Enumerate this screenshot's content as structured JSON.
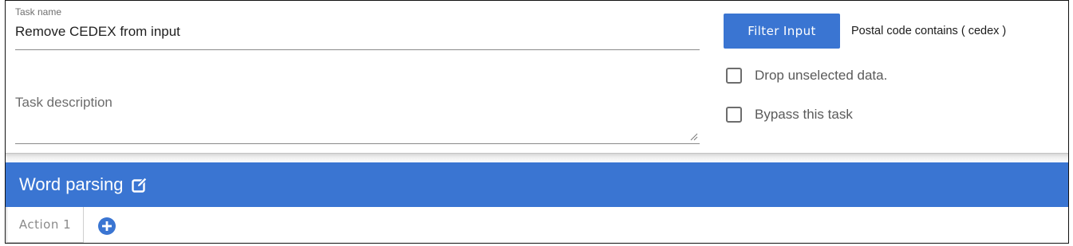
{
  "task": {
    "name_label": "Task name",
    "name_value": "Remove CEDEX from input",
    "description_placeholder": "Task description"
  },
  "filter": {
    "button_label": "Filter Input",
    "description": "Postal code contains ( cedex )"
  },
  "options": {
    "drop_unselected_label": "Drop unselected data.",
    "drop_unselected_checked": false,
    "bypass_label": "Bypass this task",
    "bypass_checked": false
  },
  "section": {
    "title": "Word parsing",
    "edit_icon": "edit-icon"
  },
  "actions": {
    "tabs": [
      "Action 1"
    ],
    "add_icon": "plus-circle-icon"
  },
  "colors": {
    "accent": "#3a75d2",
    "text_muted": "#6f6f6f"
  }
}
